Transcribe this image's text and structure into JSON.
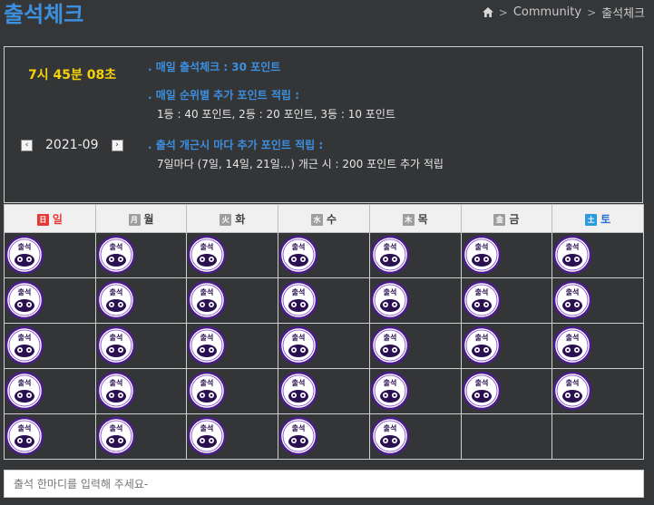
{
  "page": {
    "title": "출석체크"
  },
  "breadcrumb": {
    "home_icon": "home-icon",
    "items": [
      "Community",
      "출석체크"
    ]
  },
  "attendance": {
    "clock": "7시 45분 08초",
    "month": "2021-09",
    "prev_icon": "chevron-left-icon",
    "next_icon": "chevron-right-icon",
    "rules": [
      {
        "head": ". 매일 출석체크 : 30 포인트",
        "body": ""
      },
      {
        "head": ". 매일 순위별 추가 포인트 적립 :",
        "body": "1등 : 40 포인트,   2등 : 20 포인트,   3등 : 10 포인트"
      },
      {
        "head": ". 출석 개근시 마다 추가 포인트 적립 :",
        "body": "7일마다 (7일, 14일, 21일...) 개근 시 : 200 포인트 추가 적립"
      }
    ]
  },
  "calendar": {
    "weekdays": [
      {
        "box": "日",
        "label": "일",
        "box_color": "#e53935",
        "text_color": "#e53935"
      },
      {
        "box": "月",
        "label": "월",
        "box_color": "#9e9e9e",
        "text_color": "#444444"
      },
      {
        "box": "火",
        "label": "화",
        "box_color": "#9e9e9e",
        "text_color": "#444444"
      },
      {
        "box": "水",
        "label": "수",
        "box_color": "#9e9e9e",
        "text_color": "#444444"
      },
      {
        "box": "木",
        "label": "목",
        "box_color": "#9e9e9e",
        "text_color": "#444444"
      },
      {
        "box": "金",
        "label": "금",
        "box_color": "#9e9e9e",
        "text_color": "#444444"
      },
      {
        "box": "土",
        "label": "토",
        "box_color": "#2b9be0",
        "text_color": "#2b6fd0"
      }
    ],
    "weeks": [
      [
        1,
        1,
        1,
        1,
        1,
        1,
        1
      ],
      [
        1,
        1,
        1,
        1,
        1,
        1,
        1
      ],
      [
        1,
        1,
        1,
        1,
        1,
        1,
        1
      ],
      [
        1,
        1,
        1,
        1,
        1,
        1,
        1
      ],
      [
        1,
        1,
        1,
        1,
        1,
        0,
        0
      ]
    ],
    "stamp_icon": "attendance-stamp-icon"
  },
  "comment": {
    "placeholder": "출석 한마디를 입력해 주세요-"
  }
}
